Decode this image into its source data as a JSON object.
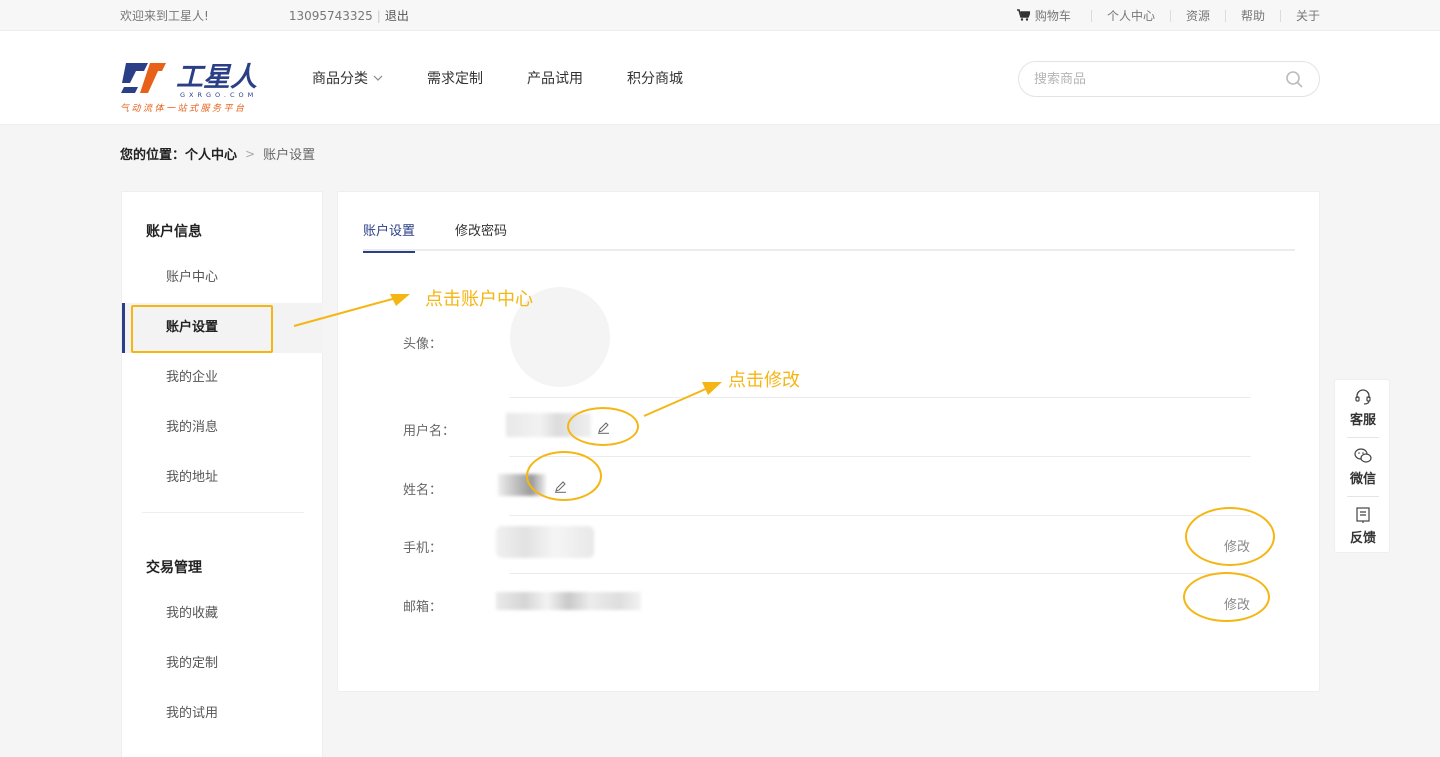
{
  "topbar": {
    "welcome": "欢迎来到工星人!",
    "phone": "13095743325",
    "logout": "退出",
    "cart": "购物车",
    "user_center": "个人中心",
    "resources": "资源",
    "help": "帮助",
    "about": "关于"
  },
  "logo": {
    "name": "工星人",
    "domain": "GXRGO.COM",
    "slogan": "气动流体一站式服务平台"
  },
  "nav": {
    "items": [
      "商品分类",
      "需求定制",
      "产品试用",
      "积分商城"
    ]
  },
  "search": {
    "placeholder": "搜索商品"
  },
  "breadcrumb": {
    "prefix": "您的位置：",
    "parent": "个人中心",
    "current": "账户设置"
  },
  "sidebar": {
    "group1_title": "账户信息",
    "group1_items": [
      "账户中心",
      "账户设置",
      "我的企业",
      "我的消息",
      "我的地址"
    ],
    "group2_title": "交易管理",
    "group2_items": [
      "我的收藏",
      "我的定制",
      "我的试用"
    ],
    "active_item": "账户设置"
  },
  "tabs": [
    "账户设置",
    "修改密码"
  ],
  "profile": {
    "avatar_label": "头像：",
    "username_label": "用户名：",
    "name_label": "姓名：",
    "phone_label": "手机：",
    "email_label": "邮箱：",
    "modify": "修改"
  },
  "annotations": {
    "click_account_center": "点击账户中心",
    "click_modify": "点击修改",
    "color": "#f5b614"
  },
  "float": {
    "service": "客服",
    "wechat": "微信",
    "feedback": "反馈"
  },
  "colors": {
    "brand_blue": "#2a3f86",
    "brand_orange": "#e8611a"
  }
}
